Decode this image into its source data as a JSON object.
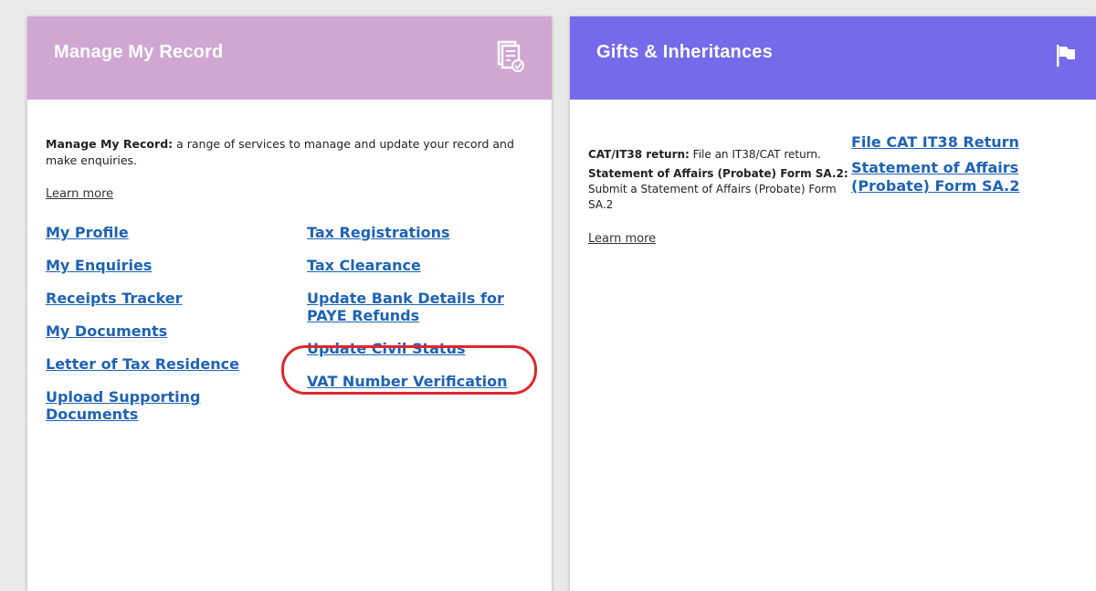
{
  "manage": {
    "title": "Manage My Record",
    "desc_bold": "Manage My Record:",
    "desc_text": " a range of services to manage and update your record and make enquiries.",
    "learn_more": "Learn more",
    "links_left": [
      "My Profile",
      "My Enquiries",
      "Receipts Tracker",
      "My Documents",
      "Letter of Tax Residence",
      "Upload Supporting Documents"
    ],
    "links_right": [
      "Tax Registrations",
      "Tax Clearance",
      "Update Bank Details for PAYE Refunds",
      "Update Civil Status",
      "VAT Number Verification"
    ],
    "header_color": "#d0a6d2",
    "icon": "document-check-icon"
  },
  "gifts": {
    "title": "Gifts & Inheritances",
    "items": [
      {
        "bold": "CAT/IT38 return:",
        "text": " File an IT38/CAT return."
      },
      {
        "bold": "Statement of Affairs (Probate) Form SA.2:",
        "text": " Submit a Statement of Affairs (Probate) Form SA.2"
      }
    ],
    "learn_more": "Learn more",
    "links": [
      "File CAT IT38 Return",
      "Statement of Affairs (Probate) Form SA.2"
    ],
    "header_color": "#7669ea",
    "icon": "flag-icon"
  },
  "link_color": "#1e63b5",
  "highlight_color": "#e0262c"
}
